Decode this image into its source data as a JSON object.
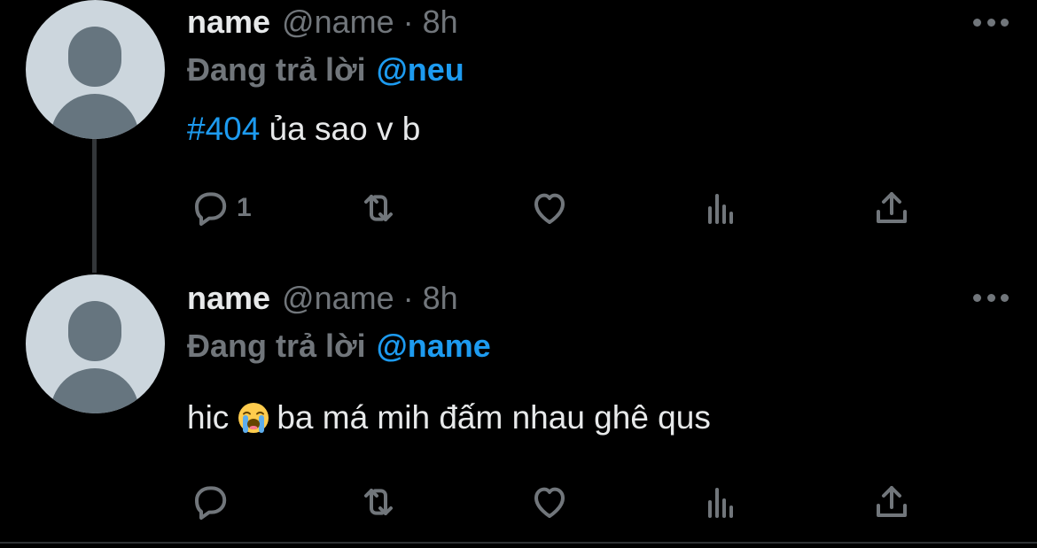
{
  "tweets": [
    {
      "display_name": "name",
      "handle": "@name",
      "separator": "·",
      "time": "8h",
      "reply_label": "Đang trả lời",
      "reply_mention": "@neu",
      "text_hashtag": "#404",
      "text_body": " ủa sao v b",
      "reply_count": "1"
    },
    {
      "display_name": "name",
      "handle": "@name",
      "separator": "·",
      "time": "8h",
      "reply_label": "Đang trả lời",
      "reply_mention": "@name",
      "text_before_emoji": "hic",
      "emoji": "loudly-crying-face",
      "text_after_emoji": "ba má mih đấm nhau ghê qus",
      "reply_count": ""
    }
  ],
  "colors": {
    "background": "#000000",
    "primary_text": "#e7e9ea",
    "secondary_text": "#71767b",
    "accent": "#1d9bf0",
    "thread_line": "#333639",
    "avatar_bg": "#ccd6dd",
    "avatar_fg": "#66757f"
  },
  "icons": [
    "reply-icon",
    "retweet-icon",
    "like-icon",
    "views-icon",
    "share-icon",
    "more-icon"
  ]
}
